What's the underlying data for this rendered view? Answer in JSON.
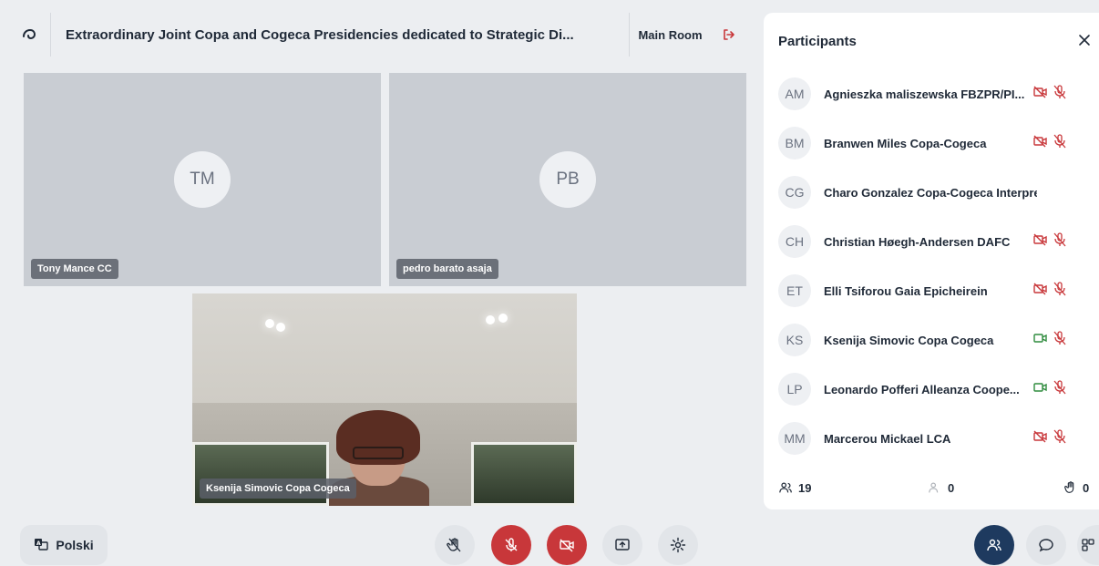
{
  "header": {
    "title": "Extraordinary Joint Copa and Cogeca Presidencies dedicated to Strategic Di...",
    "room": "Main Room"
  },
  "tiles": [
    {
      "initials": "TM",
      "name": "Tony Mance CC"
    },
    {
      "initials": "PB",
      "name": "pedro barato asaja"
    },
    {
      "name": "Ksenija Simovic Copa Cogeca"
    }
  ],
  "toolbar": {
    "language": "Polski"
  },
  "participants": {
    "title": "Participants",
    "list": [
      {
        "initials": "AM",
        "name": "Agnieszka maliszewska FBZPR/PI...",
        "video": "off",
        "mic": "off"
      },
      {
        "initials": "BM",
        "name": "Branwen Miles Copa-Cogeca",
        "video": "off",
        "mic": "off"
      },
      {
        "initials": "CG",
        "name": "Charo Gonzalez Copa-Cogeca Interpreter",
        "video": "none",
        "mic": "none"
      },
      {
        "initials": "CH",
        "name": "Christian Høegh-Andersen DAFC",
        "video": "off",
        "mic": "off"
      },
      {
        "initials": "ET",
        "name": "Elli Tsiforou Gaia Epicheirein",
        "video": "off",
        "mic": "off"
      },
      {
        "initials": "KS",
        "name": "Ksenija Simovic Copa Cogeca",
        "video": "on",
        "mic": "off"
      },
      {
        "initials": "LP",
        "name": "Leonardo Pofferi Alleanza Coope...",
        "video": "on",
        "mic": "off"
      },
      {
        "initials": "MM",
        "name": "Marcerou Mickael LCA",
        "video": "off",
        "mic": "off"
      }
    ],
    "footer": {
      "total": "19",
      "waiting": "0",
      "hands": "0"
    }
  },
  "colors": {
    "danger": "#c8373a",
    "success": "#2e8b3d",
    "navy": "#1e3a5f",
    "tile": "#c9cdd3"
  }
}
